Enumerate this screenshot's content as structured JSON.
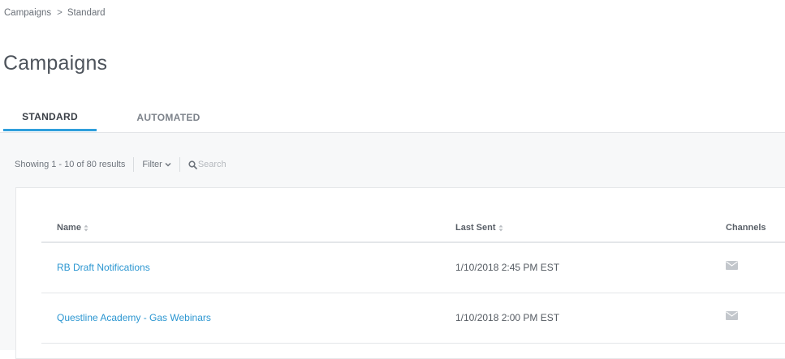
{
  "breadcrumb": {
    "items": [
      "Campaigns",
      "Standard"
    ],
    "separator": ">"
  },
  "page_title": "Campaigns",
  "tabs": [
    {
      "label": "STANDARD",
      "active": true
    },
    {
      "label": "AUTOMATED",
      "active": false
    }
  ],
  "toolbar": {
    "results_text": "Showing 1 - 10 of 80 results",
    "filter_label": "Filter",
    "search_placeholder": "Search",
    "search_value": ""
  },
  "table": {
    "columns": [
      "Name",
      "Last Sent",
      "Channels"
    ],
    "rows": [
      {
        "name": "RB Draft Notifications",
        "last_sent": "1/10/2018 2:45 PM EST",
        "channel_icon": "envelope-icon"
      },
      {
        "name": "Questline Academy - Gas Webinars",
        "last_sent": "1/10/2018 2:00 PM EST",
        "channel_icon": "envelope-icon"
      }
    ]
  },
  "colors": {
    "accent": "#2f9fdc",
    "link": "#2b96d1",
    "background_panel": "#f7f8f9"
  }
}
